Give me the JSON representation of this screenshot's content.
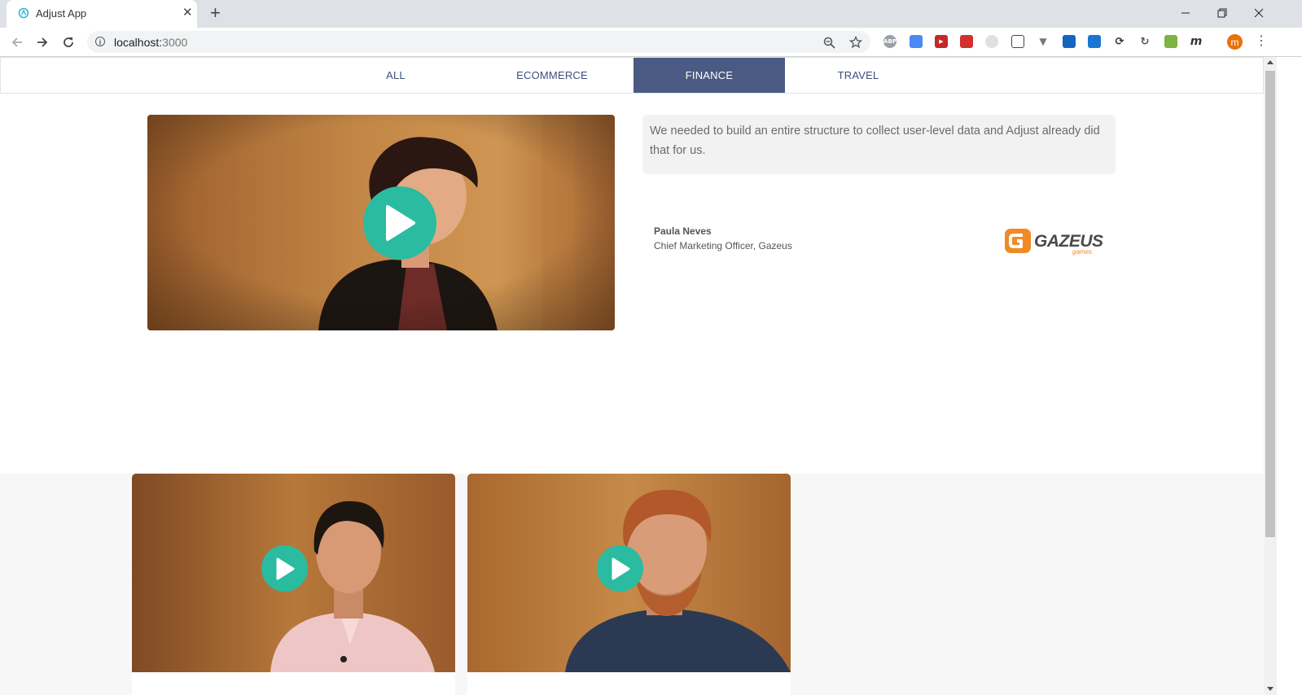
{
  "browser": {
    "tab_title": "Adjust App",
    "url_host": "localhost:",
    "url_port": "3000",
    "profile_initial": "m",
    "extensions": [
      "abp",
      "docs",
      "fast-forward",
      "red",
      "circle",
      "crop",
      "vivaldi",
      "window",
      "chat",
      "sync",
      "refresh",
      "green",
      "m"
    ]
  },
  "filters": {
    "tabs": [
      {
        "label": "ALL"
      },
      {
        "label": "ECOMMERCE"
      },
      {
        "label": "FINANCE",
        "active": true
      },
      {
        "label": "TRAVEL"
      }
    ]
  },
  "featured": {
    "quote": "We needed to build an entire structure to collect user-level data and Adjust already did that for us.",
    "name": "Paula Neves",
    "title": "Chief Marketing Officer, Gazeus",
    "logo_text": "GAZEUS",
    "logo_sub": "games"
  },
  "colors": {
    "accent_play": "#2bbba0",
    "active_tab": "#4a5a82",
    "tab_text": "#3d4f7c",
    "logo_orange": "#f08a24"
  }
}
